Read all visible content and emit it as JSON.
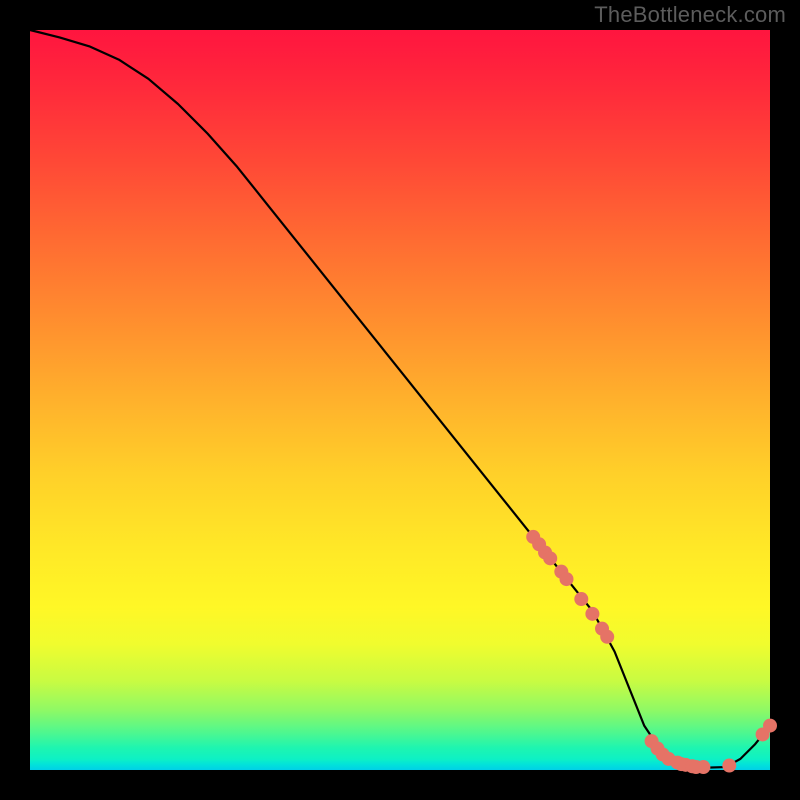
{
  "watermark": "TheBottleneck.com",
  "chart_data": {
    "type": "line",
    "title": "",
    "xlabel": "",
    "ylabel": "",
    "xlim": [
      0,
      100
    ],
    "ylim": [
      0,
      100
    ],
    "curve": {
      "x": [
        0,
        4,
        8,
        12,
        16,
        20,
        24,
        28,
        32,
        36,
        40,
        44,
        48,
        52,
        56,
        60,
        64,
        68,
        72,
        76,
        79,
        81,
        83,
        85,
        88,
        91,
        94,
        96,
        98,
        100
      ],
      "y": [
        100,
        99,
        97.8,
        96,
        93.4,
        90,
        86,
        81.5,
        76.5,
        71.5,
        66.5,
        61.5,
        56.5,
        51.5,
        46.5,
        41.5,
        36.5,
        31.5,
        26.5,
        21.5,
        16,
        11,
        6,
        3,
        0.8,
        0.3,
        0.4,
        1.5,
        3.5,
        6
      ]
    },
    "markers": {
      "color": "#e57366",
      "radius_px": 7,
      "points": [
        {
          "x": 68.0,
          "y": 31.5
        },
        {
          "x": 68.8,
          "y": 30.5
        },
        {
          "x": 69.6,
          "y": 29.4
        },
        {
          "x": 70.3,
          "y": 28.6
        },
        {
          "x": 71.8,
          "y": 26.8
        },
        {
          "x": 72.5,
          "y": 25.8
        },
        {
          "x": 74.5,
          "y": 23.1
        },
        {
          "x": 76.0,
          "y": 21.1
        },
        {
          "x": 77.3,
          "y": 19.1
        },
        {
          "x": 78.0,
          "y": 18.0
        },
        {
          "x": 84.0,
          "y": 3.9
        },
        {
          "x": 84.8,
          "y": 2.9
        },
        {
          "x": 85.5,
          "y": 2.1
        },
        {
          "x": 86.3,
          "y": 1.5
        },
        {
          "x": 87.5,
          "y": 1.0
        },
        {
          "x": 88.0,
          "y": 0.8
        },
        {
          "x": 88.6,
          "y": 0.7
        },
        {
          "x": 89.5,
          "y": 0.5
        },
        {
          "x": 90.0,
          "y": 0.4
        },
        {
          "x": 91.0,
          "y": 0.4
        },
        {
          "x": 94.5,
          "y": 0.6
        },
        {
          "x": 99.0,
          "y": 4.8
        },
        {
          "x": 100.0,
          "y": 6.0
        }
      ]
    }
  }
}
